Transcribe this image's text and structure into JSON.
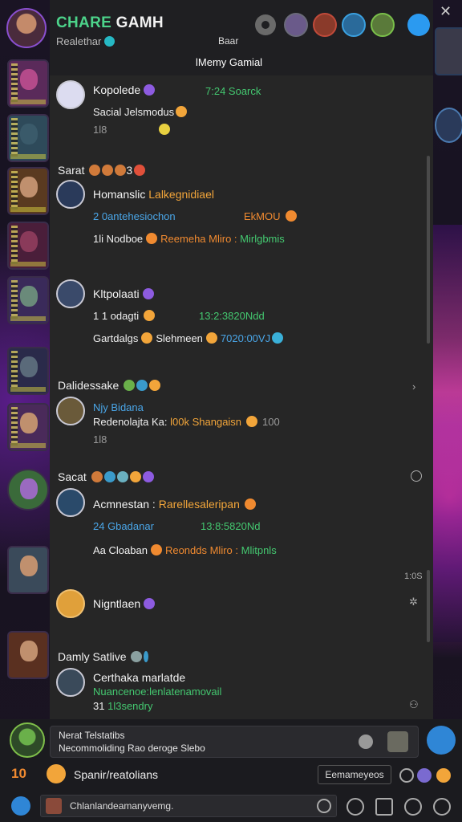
{
  "header": {
    "title_accent": "CHARE",
    "title_rest": " GAMH",
    "subtitle": "Realethar",
    "center_label": "Baar",
    "mode_label": "lMemy Gamial"
  },
  "messages": [
    {
      "user": "Kopolede",
      "line1_green": "7:24 Soarck",
      "line2": "Sacial Jelsmodus",
      "line3": "1l8"
    },
    {
      "section": "Sarat",
      "section_count": "3"
    },
    {
      "user": "Homanslic",
      "user_gold": "Lalkegnidiael",
      "line2_blue": "2 0antehesiochon",
      "line2_orange": "EkMOU",
      "line3_white": "1li  Nodboe",
      "line3_orange": "Reemeha Mliro :",
      "line3_green": "Mirlgbmis"
    },
    {
      "user": "Kltpolaati",
      "line2_white": "1 1 odagti",
      "line2_green": "13:2:3820Ndd",
      "line3_white": "Gartdalgs",
      "line3_white2": "Slehmeen",
      "line3_blue": "7020:00VJ"
    },
    {
      "section": "Dalidessake"
    },
    {
      "user_blue": "Njy Bidana",
      "line2_white": "Redenolajta Ka:",
      "line2_gold": "l00k Shangaisn",
      "line2_grey": "100",
      "line3": "1l8"
    },
    {
      "section": "Sacat"
    },
    {
      "user": "Acmnestan :",
      "user_gold": "Rarellesaleripan",
      "line2_blue": "24 Gbadanar",
      "line2_green": "13:8:5820Nd",
      "line3_white": "Aa Cloaban",
      "line3_orange": "Reondds Mliro :",
      "line3_green": "Mlitpnls"
    },
    {
      "time": "1:0S"
    },
    {
      "user": "Nigntlaen"
    },
    {
      "section": "Damly Satlive"
    },
    {
      "user": "Certhaka  marlatde",
      "line2_green": "Nuancenoe:lenlatenamovail",
      "line3_white": "31",
      "line3_green": "1l3sendry"
    }
  ],
  "composer": {
    "line1": "Nerat Telstatibs",
    "line2": "Necommoliding Rao deroge Slebo"
  },
  "footer": {
    "level": "10",
    "party_label": "Spanir/reatolians",
    "room_button": "Eemameyeos",
    "bottom_input": "Chlanlandeamanyvemg."
  },
  "colors": {
    "accent_green": "#4cd38a",
    "gold": "#f2a53a",
    "blue": "#4aa6e8",
    "purple": "#8d5be0"
  }
}
